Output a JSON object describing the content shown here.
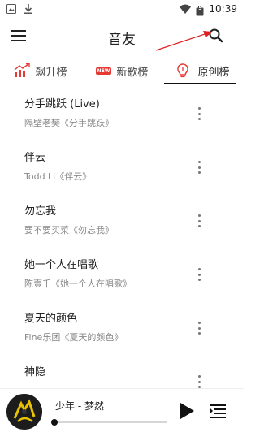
{
  "status_bar": {
    "time": "10:39",
    "battery_level": "5",
    "icons": [
      "photo-icon",
      "download-icon",
      "wifi-icon",
      "battery-icon"
    ]
  },
  "header": {
    "title": "音友",
    "icons": [
      "menu-icon",
      "search-icon"
    ]
  },
  "tabs": [
    {
      "label": "飙升榜",
      "icon": "chart-icon",
      "active": false
    },
    {
      "label": "新歌榜",
      "icon": "new-badge",
      "badge": "NEW",
      "active": false
    },
    {
      "label": "原创榜",
      "icon": "lightbulb-icon",
      "active": true
    }
  ],
  "songs": [
    {
      "title": "分手跳跃 (Live)",
      "subtitle": "隔壁老樊《分手跳跃》"
    },
    {
      "title": "伴云",
      "subtitle": "Todd Li《伴云》"
    },
    {
      "title": "勿忘我",
      "subtitle": "要不要买菜《勿忘我》"
    },
    {
      "title": "她一个人在唱歌",
      "subtitle": "陈壹千《她一个人在唱歌》"
    },
    {
      "title": "夏天的颜色",
      "subtitle": "Fine乐团《夏天的颜色》"
    },
    {
      "title": "神隐",
      "subtitle": ""
    }
  ],
  "player": {
    "now_playing": "少年 - 梦然",
    "progress": 0.0
  },
  "colors": {
    "accent_red": "#e53935",
    "text_primary": "#222222",
    "text_secondary": "#888888"
  }
}
